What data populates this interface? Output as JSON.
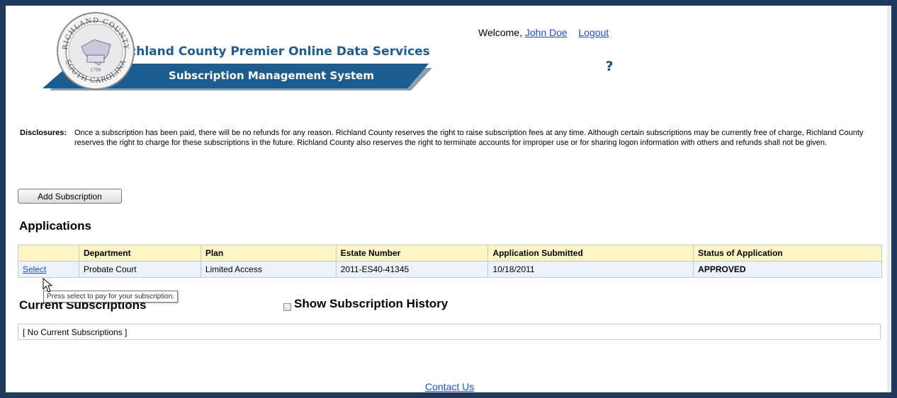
{
  "header": {
    "title_line1": "Richland County Premier Online Data Services",
    "title_line2": "Subscription Management System",
    "seal_top_text": "RICHLAND COUNTY",
    "seal_bottom_text": "SOUTH CAROLINA",
    "seal_year": "1799",
    "welcome_text": "Welcome,",
    "user_name": "John Doe",
    "logout_label": "Logout",
    "help_icon": "help-question-icon"
  },
  "disclosures": {
    "label": "Disclosures:",
    "text": "Once a subscription has been paid, there will be no refunds for any reason. Richland County reserves the right to raise subscription fees at any time. Although certain subscriptions may be currently free of charge, Richland County reserves the right to charge for these subscriptions in the future. Richland County also reserves the right to terminate accounts for improper use or for sharing logon information with others and refunds shall not be given."
  },
  "actions": {
    "add_subscription_label": "Add Subscription"
  },
  "applications": {
    "title": "Applications",
    "columns": [
      "",
      "Department",
      "Plan",
      "Estate Number",
      "Application Submitted",
      "Status of Application"
    ],
    "rows": [
      {
        "action": "Select",
        "department": "Probate Court",
        "plan": "Limited Access",
        "estate_number": "2011-ES40-41345",
        "submitted": "10/18/2011",
        "status": "APPROVED"
      }
    ]
  },
  "tooltip": {
    "text": "Press select to pay for your subscription."
  },
  "current_subscriptions": {
    "title": "Current Subscriptions",
    "show_history_label": "Show Subscription History",
    "show_history_checked": false,
    "empty_text": "[ No Current Subscriptions ]"
  },
  "footer": {
    "contact_label": "Contact Us"
  },
  "colors": {
    "banner_blue": "#1c5c8e",
    "header_row": "#fdf5c4",
    "data_row": "#ecf2fa",
    "link": "#1a4fd6"
  }
}
